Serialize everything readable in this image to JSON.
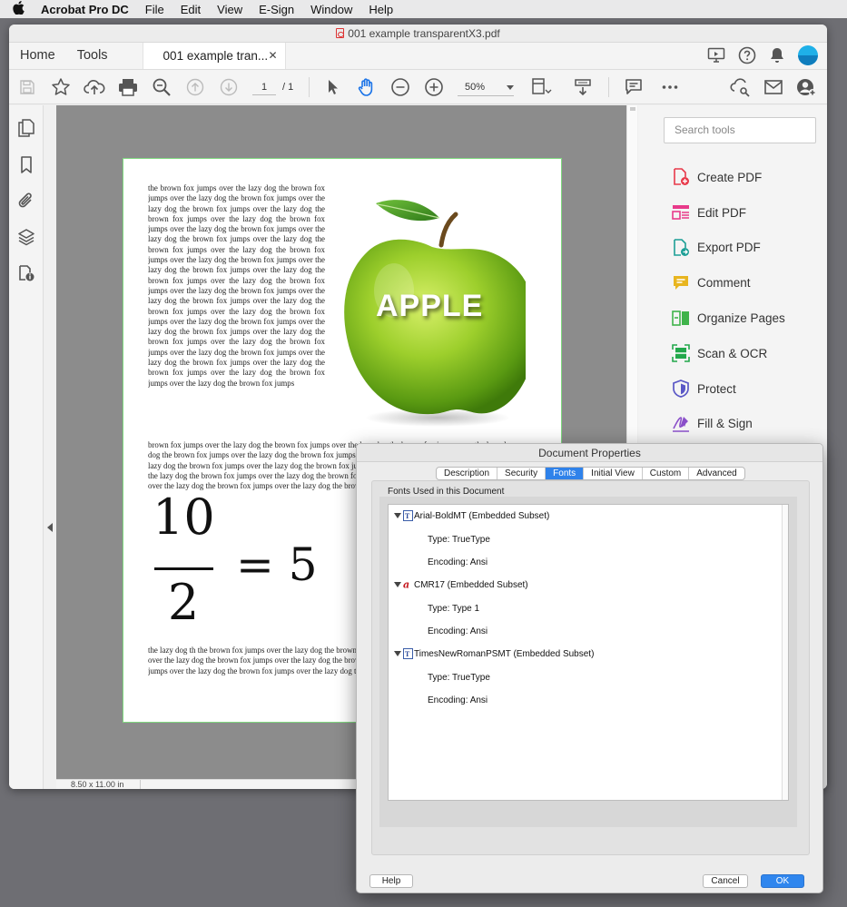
{
  "menubar": {
    "app": "Acrobat Pro DC",
    "items": [
      "File",
      "Edit",
      "View",
      "E-Sign",
      "Window",
      "Help"
    ]
  },
  "window": {
    "title": "001 example transparentX3.pdf"
  },
  "tabs": {
    "home": "Home",
    "tools": "Tools",
    "doc": "001 example tran...",
    "close": "✕"
  },
  "toolbar": {
    "page_current": "1",
    "page_total": "/   1",
    "zoom": "50%"
  },
  "status": {
    "page_size": "8.50 x 11.00 in"
  },
  "document": {
    "column_text": "the brown fox jumps over the lazy dog the brown fox jumps over  the lazy dog the brown fox jumps over the lazy dog  the brown fox jumps over the lazy dog the brown fox jumps over the lazy dog the brown fox jumps over the lazy dog the brown fox jumps over the lazy dog the brown fox jumps over the lazy dog the brown fox jumps over the lazy dog the brown fox jumps over the lazy dog the brown fox jumps over the lazy dog the brown fox jumps over the lazy dog the brown fox jumps over the lazy dog the brown fox jumps over the lazy dog the brown fox jumps over the lazy dog the brown fox jumps over the lazy dog the brown fox jumps over the lazy dog the brown fox jumps over the lazy dog the brown fox jumps over the lazy dog the brown fox jumps over the lazy dog the brown fox jumps over the lazy dog the brown fox jumps over the lazy dog the brown fox jumps over the lazy dog the brown fox jumps over the lazy dog the brown fox jumps over the lazy dog the brown fox jumps over the lazy dog the brown fox jumps",
    "wide_lines": [
      "brown fox jumps over the lazy dog the brown fox jumps over the lazy dog the brown fox jumps over the lazy dog",
      "dog the brown fox jumps over the lazy dog the brown fox jumps over the lazy dog the brown fox jumps over the",
      "lazy dog the brown fox jumps over the lazy dog the brown fox jumps over the lazy dog the brown fox jumps",
      "the lazy dog the brown fox jumps over the lazy dog the brown fox jumps over the lazy dog the brown fox",
      "over the lazy dog the brown fox jumps over the lazy dog the brown fox jumps over the lazy dog the brown"
    ],
    "apple_label": "APPLE",
    "equation": {
      "numerator": "10",
      "denominator": "2",
      "rest": "= 5"
    },
    "after_lines": [
      "the lazy dog th the brown fox jumps over the lazy dog the brown fox jumps over the lazy dog",
      "over the lazy dog the brown fox jumps over the lazy dog the brown fox jumps over the lazy dog",
      "jumps over the lazy dog the brown fox jumps over the lazy dog the brown fox jumps over the"
    ]
  },
  "tools_panel": {
    "search_placeholder": "Search tools",
    "items": [
      {
        "label": "Create PDF",
        "icon": "create-pdf-icon",
        "color": "#e8394a"
      },
      {
        "label": "Edit PDF",
        "icon": "edit-pdf-icon",
        "color": "#e83a8a"
      },
      {
        "label": "Export PDF",
        "icon": "export-pdf-icon",
        "color": "#1d9f96"
      },
      {
        "label": "Comment",
        "icon": "comment-icon",
        "color": "#e8b51f"
      },
      {
        "label": "Organize Pages",
        "icon": "organize-pages-icon",
        "color": "#3fb34a"
      },
      {
        "label": "Scan & OCR",
        "icon": "scan-ocr-icon",
        "color": "#22a84b"
      },
      {
        "label": "Protect",
        "icon": "protect-icon",
        "color": "#5a57c6"
      },
      {
        "label": "Fill & Sign",
        "icon": "fill-sign-icon",
        "color": "#8a4fc9"
      }
    ]
  },
  "dialog": {
    "title": "Document Properties",
    "tabs": [
      "Description",
      "Security",
      "Fonts",
      "Initial View",
      "Custom",
      "Advanced"
    ],
    "active_tab": "Fonts",
    "section_label": "Fonts Used in this Document",
    "fonts": [
      {
        "name": "Arial-BoldMT (Embedded Subset)",
        "type": "Type: TrueType",
        "encoding": "Encoding: Ansi",
        "icon": "truetype-font-icon"
      },
      {
        "name": "CMR17 (Embedded Subset)",
        "type": "Type: Type 1",
        "encoding": "Encoding: Ansi",
        "icon": "type1-font-icon"
      },
      {
        "name": "TimesNewRomanPSMT (Embedded Subset)",
        "type": "Type: TrueType",
        "encoding": "Encoding: Ansi",
        "icon": "truetype-font-icon"
      }
    ],
    "help": "Help",
    "cancel": "Cancel",
    "ok": "OK"
  },
  "colors": {
    "accent": "#2f82ea",
    "page_border": "#7fd97f"
  }
}
